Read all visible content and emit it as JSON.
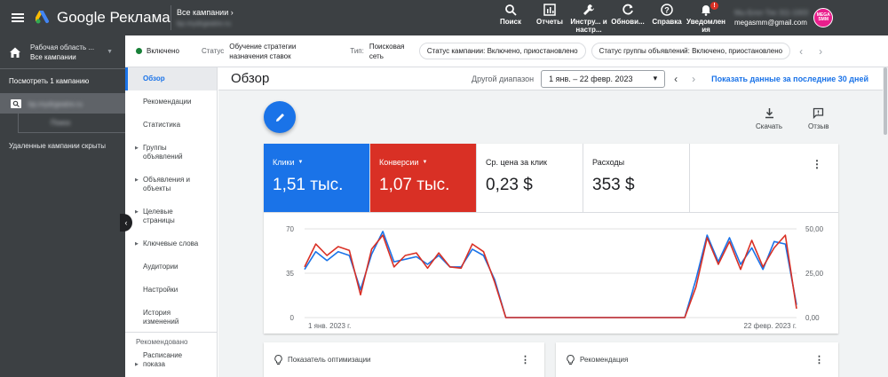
{
  "topbar": {
    "logo_text": "Google Реклама",
    "campaign_switch_label": "Все кампании",
    "campaign_switch_account": "bp.mydrgeatre.ru",
    "actions": [
      {
        "label": "Поиск",
        "icon": "search-icon"
      },
      {
        "label": "Отчеты",
        "icon": "reports-icon"
      },
      {
        "label": "Инстру... и настр...",
        "icon": "tools-icon"
      },
      {
        "label": "Обнови...",
        "icon": "refresh-icon"
      },
      {
        "label": "Справка",
        "icon": "help-icon"
      },
      {
        "label": "Уведомлен ия",
        "icon": "bell-icon",
        "badge": "!"
      }
    ],
    "account_id": "Мы-Блог-Тех 311-1003",
    "account_email": "megasmm@gmail.com",
    "avatar_text": "MEGA SMM"
  },
  "sidebar": {
    "workspace_line1": "Рабочая область ...",
    "workspace_line2": "Все кампании",
    "view_campaign": "Посмотреть 1 кампанию",
    "campaign_name": "bp.mydrgeatre.ru",
    "campaign_sub": "Поиск",
    "hidden_campaigns": "Удаленные кампании скрыты"
  },
  "statusbar": {
    "enabled": "Включено",
    "status_label": "Статус",
    "status_value_1": "Обучение стратегии",
    "status_value_2": "назначения ставок",
    "type_label": "Тип:",
    "type_value_1": "Поисковая",
    "type_value_2": "сеть",
    "chip_campaign": "Статус кампании: Включено, приостановлено",
    "chip_adgroup": "Статус группы объявлений: Включено, приостановлено"
  },
  "nav": {
    "items": [
      {
        "label": "Обзор",
        "active": true
      },
      {
        "label": "Рекомендации"
      },
      {
        "label": "Статистика"
      },
      {
        "label": "Группы объявлений",
        "arrow": true
      },
      {
        "label": "Объявления и объекты",
        "arrow": true
      },
      {
        "label": "Целевые страницы",
        "arrow": true
      },
      {
        "label": "Ключевые слова",
        "arrow": true
      },
      {
        "label": "Аудитории"
      },
      {
        "label": "Настройки"
      },
      {
        "label": "История изменений"
      }
    ],
    "section": "Рекомендовано",
    "section_items": [
      {
        "label": "Расписание показа",
        "arrow": true
      }
    ]
  },
  "main": {
    "title": "Обзор",
    "range_label": "Другой диапазон",
    "date_range": "1 янв. – 22 февр. 2023",
    "last30": "Показать данные за последние 30 дней",
    "download_label": "Скачать",
    "feedback_label": "Отзыв"
  },
  "metrics": [
    {
      "label": "Клики",
      "value": "1,51 тыс.",
      "color": "#1a73e8"
    },
    {
      "label": "Конверсии",
      "value": "1,07 тыс.",
      "color": "#d93025"
    },
    {
      "label": "Ср. цена за клик",
      "value": "0,23 $"
    },
    {
      "label": "Расходы",
      "value": "353 $"
    }
  ],
  "chart_data": {
    "type": "line",
    "x_labels": [
      "1 янв. 2023 г.",
      "22 февр. 2023 г."
    ],
    "y_left_ticks": [
      "70",
      "35",
      "0"
    ],
    "y_right_ticks": [
      "50,00",
      "25,00",
      "0,00"
    ],
    "ylim_left": [
      0,
      70
    ],
    "ylim_right": [
      0,
      50
    ],
    "series": [
      {
        "name": "Клики",
        "color": "#1a73e8",
        "values": [
          38,
          52,
          45,
          52,
          49,
          22,
          50,
          68,
          44,
          46,
          48,
          42,
          49,
          40,
          40,
          54,
          49,
          30,
          0,
          0,
          0,
          0,
          0,
          0,
          0,
          0,
          0,
          0,
          0,
          0,
          0,
          0,
          0,
          0,
          0,
          30,
          65,
          44,
          63,
          42,
          55,
          38,
          60,
          58,
          10
        ]
      },
      {
        "name": "Конверсии",
        "color": "#d93025",
        "values": [
          40,
          58,
          49,
          56,
          53,
          18,
          54,
          65,
          40,
          49,
          51,
          39,
          51,
          40,
          39,
          58,
          52,
          28,
          0,
          0,
          0,
          0,
          0,
          0,
          0,
          0,
          0,
          0,
          0,
          0,
          0,
          0,
          0,
          0,
          0,
          24,
          63,
          42,
          60,
          38,
          61,
          40,
          55,
          65,
          7
        ]
      }
    ]
  },
  "bottom": {
    "optimization": "Показатель оптимизации",
    "recommendation": "Рекомендация"
  }
}
